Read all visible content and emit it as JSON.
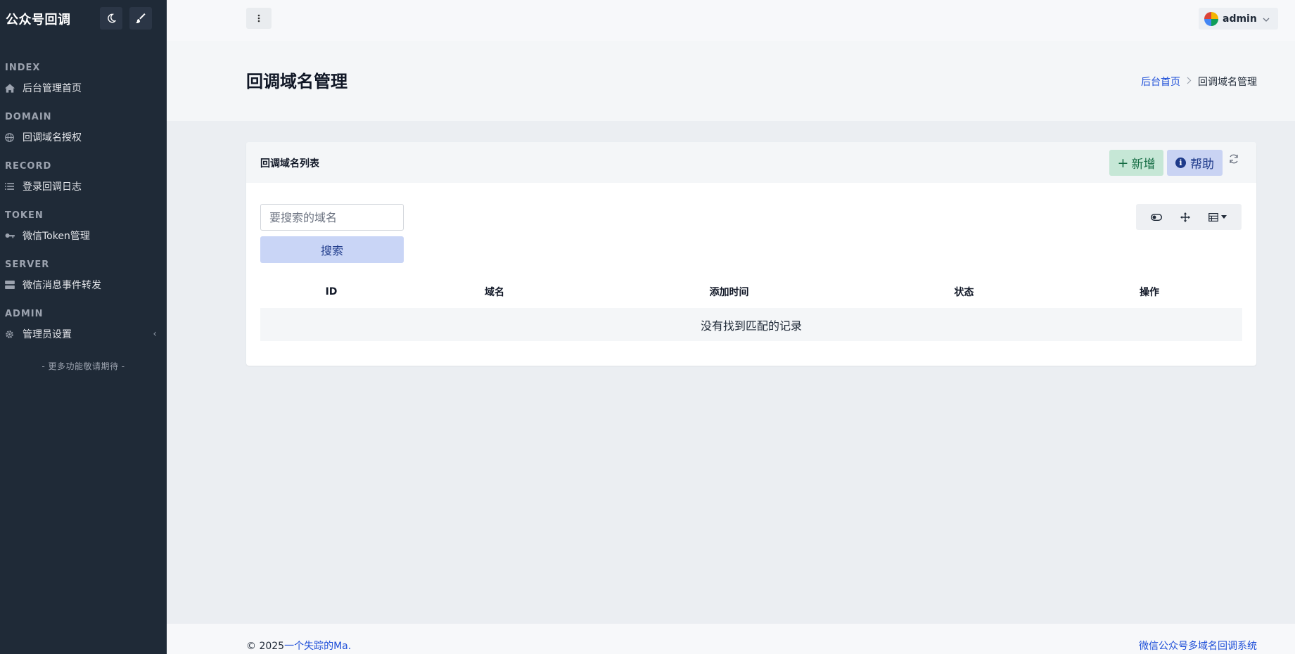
{
  "app": {
    "brand": "公众号回调"
  },
  "sidebar": {
    "sections": [
      {
        "title": "INDEX",
        "item": "后台管理首页",
        "icon": "home-icon"
      },
      {
        "title": "DOMAIN",
        "item": "回调域名授权",
        "icon": "globe-icon"
      },
      {
        "title": "RECORD",
        "item": "登录回调日志",
        "icon": "list-icon"
      },
      {
        "title": "TOKEN",
        "item": "微信Token管理",
        "icon": "key-icon"
      },
      {
        "title": "SERVER",
        "item": "微信消息事件转发",
        "icon": "server-icon"
      },
      {
        "title": "ADMIN",
        "item": "管理员设置",
        "icon": "gear-icon"
      }
    ],
    "more": "- 更多功能敬请期待 -"
  },
  "topbar": {
    "user": "admin"
  },
  "page": {
    "title": "回调域名管理",
    "breadcrumb": {
      "home": "后台首页",
      "current": "回调域名管理"
    }
  },
  "card": {
    "title": "回调域名列表",
    "add_label": "新增",
    "help_label": "帮助",
    "search": {
      "placeholder": "要搜索的域名",
      "button": "搜索"
    },
    "table": {
      "columns": [
        "ID",
        "域名",
        "添加时间",
        "状态",
        "操作"
      ],
      "empty": "没有找到匹配的记录"
    }
  },
  "footer": {
    "copyright": "© 2025",
    "author": "一个失踪的Ma.",
    "system": "微信公众号多域名回调系统"
  },
  "colors": {
    "sidebar_bg": "#1f2a37",
    "link": "#1d4ed8",
    "add_button_bg": "#c6e7d6",
    "help_button_bg": "#c9d3f3"
  }
}
